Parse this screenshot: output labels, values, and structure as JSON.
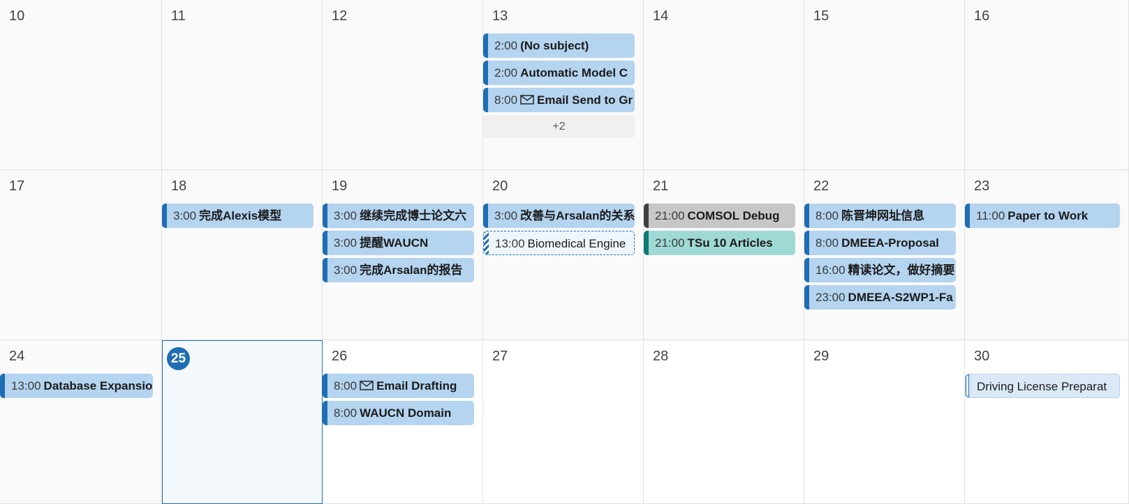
{
  "colors": {
    "accent": "#1f6db3",
    "event_bg": "#b4d4ef",
    "gray": "#404040",
    "teal": "#0e7c73"
  },
  "weeks": [
    {
      "days": [
        {
          "num": "10",
          "events": []
        },
        {
          "num": "11",
          "events": []
        },
        {
          "num": "12",
          "events": []
        },
        {
          "num": "13",
          "events": [
            {
              "time": "2:00",
              "title": "(No subject)"
            },
            {
              "time": "2:00",
              "title": "Automatic Model C"
            },
            {
              "time": "8:00",
              "title": "Email Send to Gr",
              "icon": "mail-icon"
            }
          ],
          "more": "+2"
        },
        {
          "num": "14",
          "events": []
        },
        {
          "num": "15",
          "events": []
        },
        {
          "num": "16",
          "events": []
        }
      ]
    },
    {
      "days": [
        {
          "num": "17",
          "events": []
        },
        {
          "num": "18",
          "events": [
            {
              "time": "3:00",
              "title": "完成Alexis模型"
            }
          ]
        },
        {
          "num": "19",
          "events": [
            {
              "time": "3:00",
              "title": "继续完成博士论文六"
            },
            {
              "time": "3:00",
              "title": "提醒WAUCN"
            },
            {
              "time": "3:00",
              "title": "完成Arsalan的报告"
            }
          ]
        },
        {
          "num": "20",
          "events": [
            {
              "time": "3:00",
              "title": "改善与Arsalan的关系"
            },
            {
              "time": "13:00",
              "title": "Biomedical Engine",
              "style": "tentative"
            }
          ]
        },
        {
          "num": "21",
          "events": [
            {
              "time": "21:00",
              "title": "COMSOL Debug",
              "style": "gray"
            },
            {
              "time": "21:00",
              "title": "TSu 10 Articles",
              "style": "teal"
            }
          ]
        },
        {
          "num": "22",
          "events": [
            {
              "time": "8:00",
              "title": "陈晋坤网址信息"
            },
            {
              "time": "8:00",
              "title": "DMEEA-Proposal"
            },
            {
              "time": "16:00",
              "title": "精读论文，做好摘要"
            },
            {
              "time": "23:00",
              "title": "DMEEA-S2WP1-Fa"
            }
          ]
        },
        {
          "num": "23",
          "events": [
            {
              "time": "11:00",
              "title": "Paper to Work"
            }
          ]
        }
      ]
    },
    {
      "days": [
        {
          "num": "24",
          "events": [
            {
              "time": "13:00",
              "title": "Database Expansio"
            }
          ]
        },
        {
          "num": "25",
          "today": true,
          "events": []
        },
        {
          "num": "26",
          "events": [
            {
              "time": "8:00",
              "title": "Email Drafting",
              "icon": "mail-icon"
            },
            {
              "time": "8:00",
              "title": "WAUCN Domain"
            }
          ]
        },
        {
          "num": "27",
          "events": []
        },
        {
          "num": "28",
          "events": []
        },
        {
          "num": "29",
          "events": []
        },
        {
          "num": "30",
          "events": [
            {
              "time": "",
              "title": "Driving License Preparat",
              "style": "allday"
            }
          ]
        }
      ]
    }
  ]
}
